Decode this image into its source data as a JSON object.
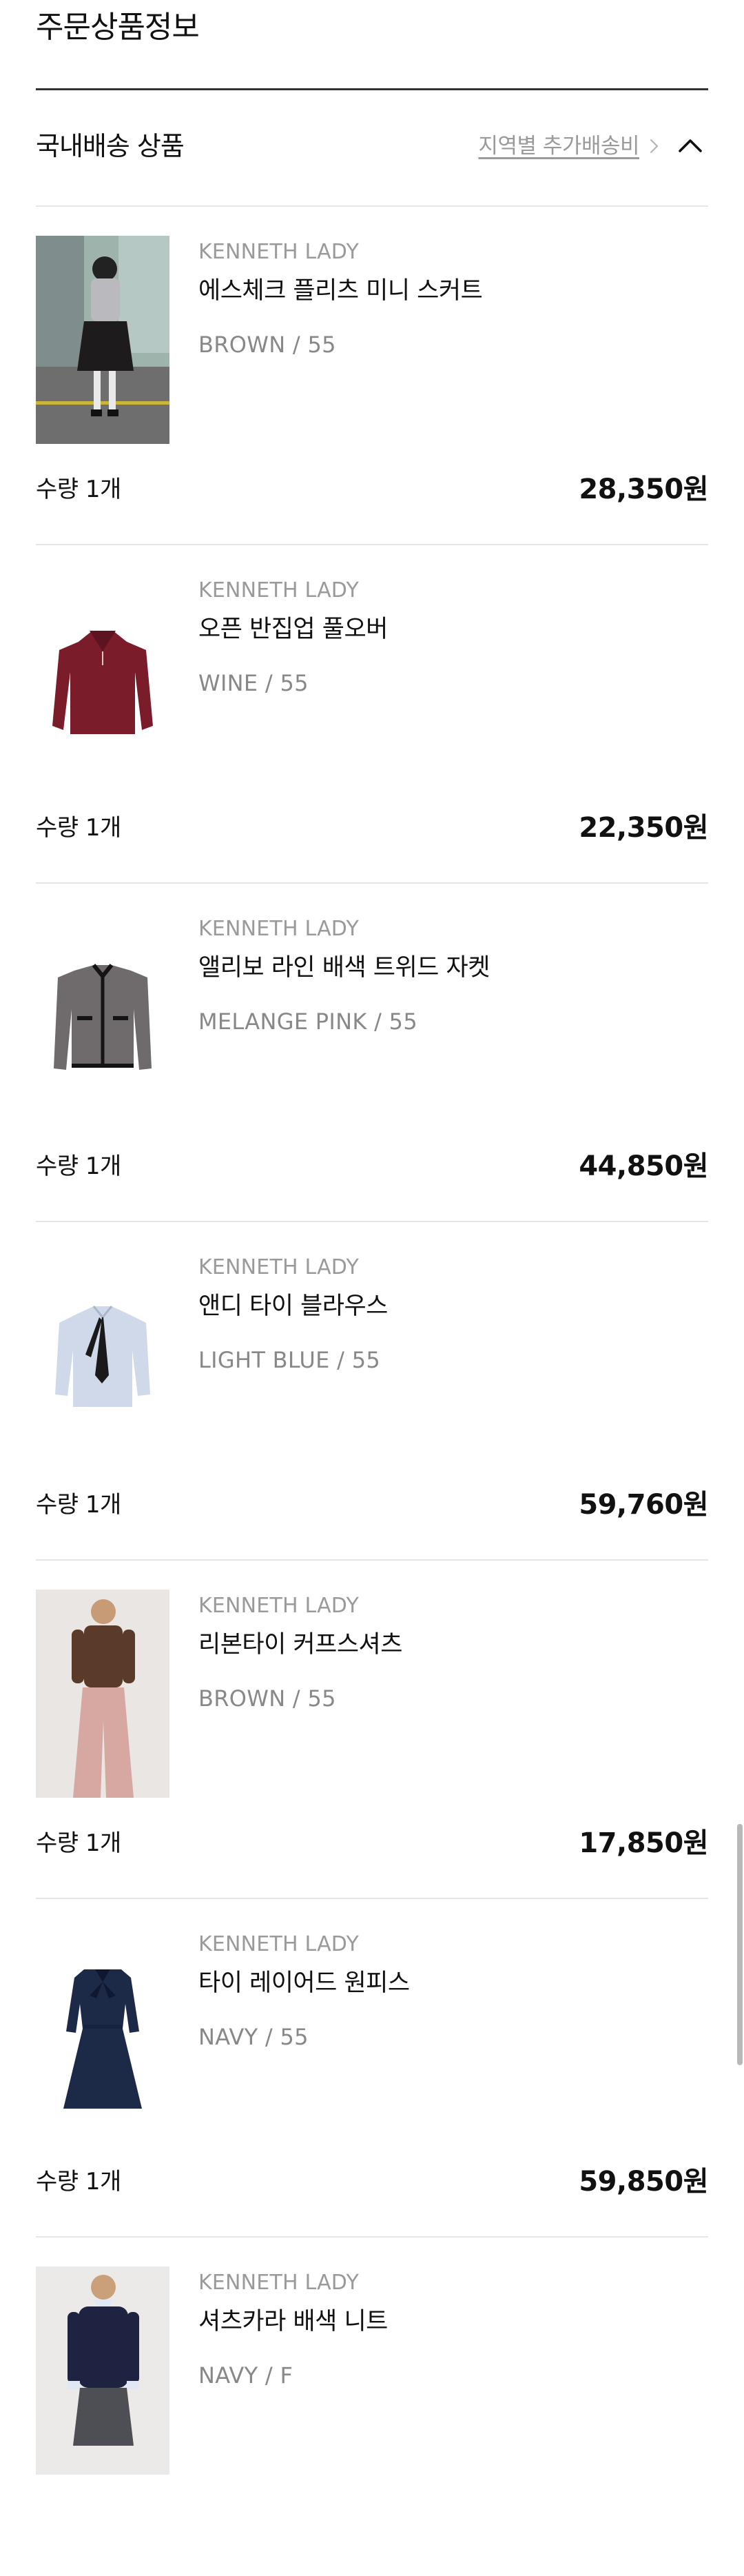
{
  "section": {
    "title": "주문상품정보"
  },
  "group": {
    "title": "국내배송 상품",
    "shipping_link": "지역별 추가배송비"
  },
  "items": [
    {
      "brand": "KENNETH LADY",
      "name": "에스체크 플리츠 미니 스커트",
      "option": "BROWN / 55",
      "qty": "수량 1개",
      "price": "28,350원",
      "image": "model-photo-skirt"
    },
    {
      "brand": "KENNETH LADY",
      "name": "오픈 반집업 풀오버",
      "option": "WINE / 55",
      "qty": "수량 1개",
      "price": "22,350원",
      "image": "wine-pullover-product"
    },
    {
      "brand": "KENNETH LADY",
      "name": "앨리보 라인 배색 트위드 자켓",
      "option": "MELANGE PINK / 55",
      "qty": "수량 1개",
      "price": "44,850원",
      "image": "tweed-jacket-product"
    },
    {
      "brand": "KENNETH LADY",
      "name": "앤디 타이 블라우스",
      "option": "LIGHT BLUE / 55",
      "qty": "수량 1개",
      "price": "59,760원",
      "image": "blue-blouse-product"
    },
    {
      "brand": "KENNETH LADY",
      "name": "리본타이 커프스셔츠",
      "option": "BROWN / 55",
      "qty": "수량 1개",
      "price": "17,850원",
      "image": "model-photo-brown-shirt"
    },
    {
      "brand": "KENNETH LADY",
      "name": "타이 레이어드 원피스",
      "option": "NAVY / 55",
      "qty": "수량 1개",
      "price": "59,850원",
      "image": "navy-dress-product"
    },
    {
      "brand": "KENNETH LADY",
      "name": "셔츠카라 배색 니트",
      "option": "NAVY / F",
      "image": "model-photo-navy-knit"
    }
  ],
  "colors": {
    "text_primary": "#111111",
    "text_secondary": "#9a9a9a",
    "divider": "#e5e5e5",
    "section_rule": "#333333"
  }
}
